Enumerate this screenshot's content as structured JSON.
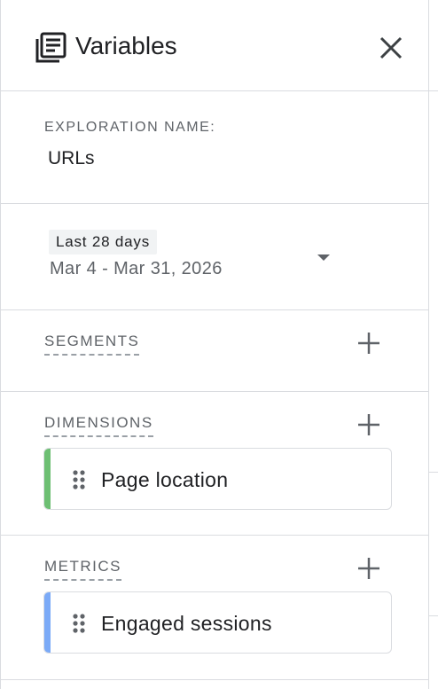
{
  "header": {
    "title": "Variables",
    "icon": "variables-list-icon",
    "close_icon": "close-icon"
  },
  "exploration": {
    "label": "EXPLORATION NAME:",
    "value": "URLs"
  },
  "date_range": {
    "preset": "Last 28 days",
    "range": "Mar 4 - Mar 31, 2026",
    "dropdown_icon": "caret-down-icon"
  },
  "segments": {
    "label": "SEGMENTS",
    "items": []
  },
  "dimensions": {
    "label": "DIMENSIONS",
    "items": [
      {
        "label": "Page location",
        "color": "#6dbf73"
      }
    ]
  },
  "metrics": {
    "label": "METRICS",
    "items": [
      {
        "label": "Engaged sessions",
        "color": "#7baaf7"
      }
    ]
  },
  "colors": {
    "text_primary": "#202124",
    "text_secondary": "#5f6368",
    "divider": "#dadce0",
    "dimension_accent": "#6dbf73",
    "metric_accent": "#7baaf7"
  }
}
